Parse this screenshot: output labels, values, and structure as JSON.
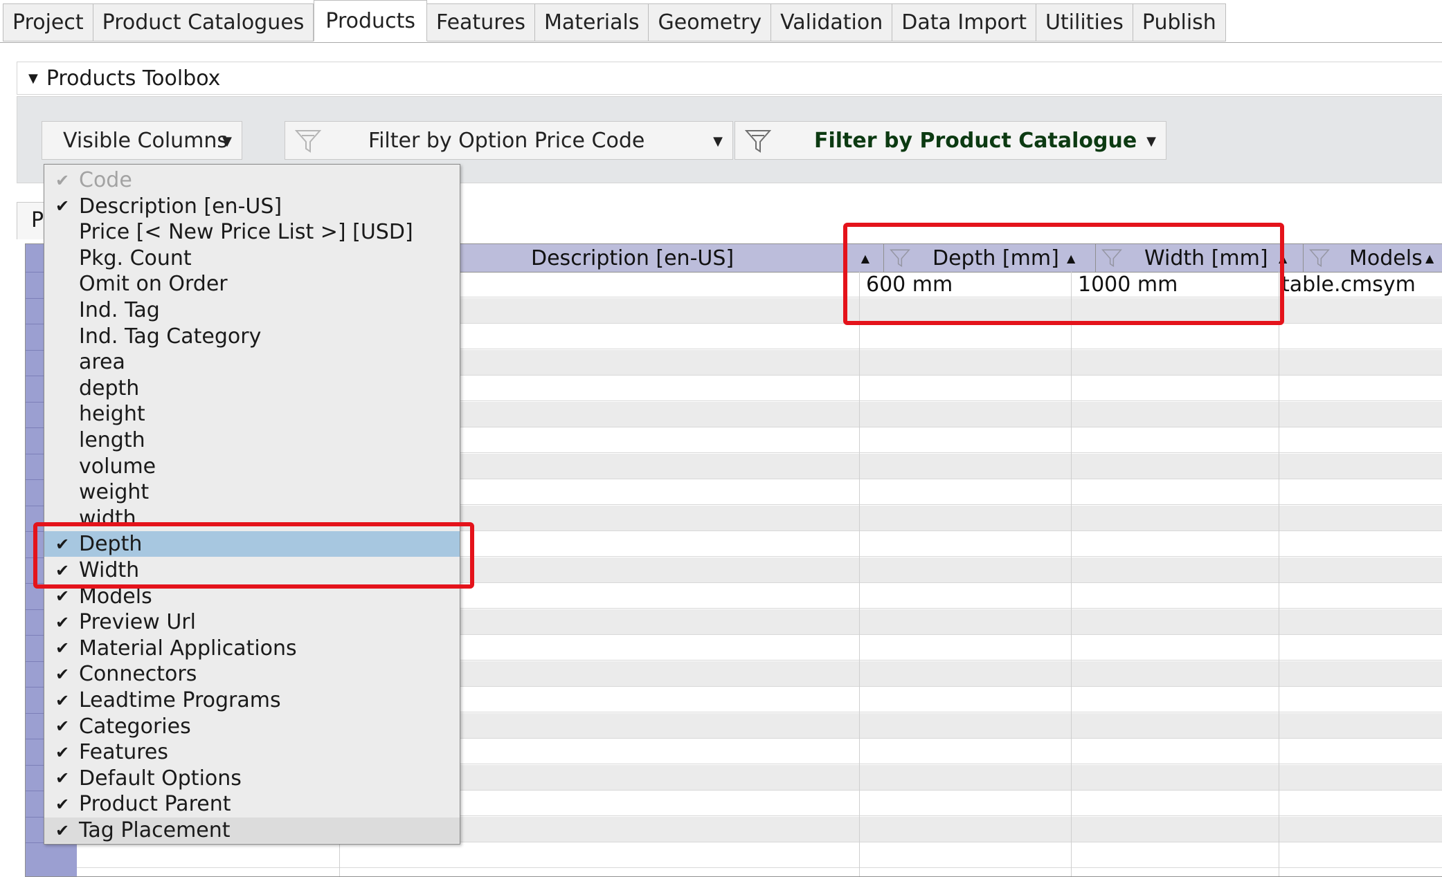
{
  "tabs": [
    "Project",
    "Product Catalogues",
    "Products",
    "Features",
    "Materials",
    "Geometry",
    "Validation",
    "Data Import",
    "Utilities",
    "Publish"
  ],
  "active_tab": "Products",
  "toolbox": {
    "title": "Products Toolbox",
    "visible_columns_label": "Visible Columns",
    "filter_price_label": "Filter by Option Price Code",
    "filter_catalogue_label": "Filter by Product Catalogue"
  },
  "panel_tab_label": "P",
  "grid": {
    "headers": {
      "description": "Description [en-US]",
      "depth": "Depth [mm]",
      "width": "Width [mm]",
      "models": "Models"
    },
    "first_row": {
      "depth": "600 mm",
      "width": "1000 mm",
      "models": "table.cmsym"
    }
  },
  "menu_items": [
    {
      "label": "Code",
      "checked": true,
      "state": "disabled"
    },
    {
      "label": "Description [en-US]",
      "checked": true,
      "state": "normal"
    },
    {
      "label": "Price [< New Price List >] [USD]",
      "checked": false,
      "state": "normal"
    },
    {
      "label": "Pkg. Count",
      "checked": false,
      "state": "normal"
    },
    {
      "label": "Omit on Order",
      "checked": false,
      "state": "normal"
    },
    {
      "label": "Ind. Tag",
      "checked": false,
      "state": "normal"
    },
    {
      "label": "Ind. Tag Category",
      "checked": false,
      "state": "normal"
    },
    {
      "label": "area",
      "checked": false,
      "state": "normal"
    },
    {
      "label": "depth",
      "checked": false,
      "state": "normal"
    },
    {
      "label": "height",
      "checked": false,
      "state": "normal"
    },
    {
      "label": "length",
      "checked": false,
      "state": "normal"
    },
    {
      "label": "volume",
      "checked": false,
      "state": "normal"
    },
    {
      "label": "weight",
      "checked": false,
      "state": "normal"
    },
    {
      "label": "width",
      "checked": false,
      "state": "normal"
    },
    {
      "label": "Depth",
      "checked": true,
      "state": "selected"
    },
    {
      "label": "Width",
      "checked": true,
      "state": "normal"
    },
    {
      "label": "Models",
      "checked": true,
      "state": "normal"
    },
    {
      "label": "Preview Url",
      "checked": true,
      "state": "normal"
    },
    {
      "label": "Material Applications",
      "checked": true,
      "state": "normal"
    },
    {
      "label": "Connectors",
      "checked": true,
      "state": "normal"
    },
    {
      "label": "Leadtime Programs",
      "checked": true,
      "state": "normal"
    },
    {
      "label": "Categories",
      "checked": true,
      "state": "normal"
    },
    {
      "label": "Features",
      "checked": true,
      "state": "normal"
    },
    {
      "label": "Default Options",
      "checked": true,
      "state": "normal"
    },
    {
      "label": "Product Parent",
      "checked": true,
      "state": "normal"
    },
    {
      "label": "Tag Placement",
      "checked": true,
      "state": "last"
    }
  ],
  "check_glyph": "✔",
  "colors": {
    "highlight_red": "#e4131b",
    "header_blue": "#bcbddb",
    "selected_item": "#a7c7e0"
  }
}
